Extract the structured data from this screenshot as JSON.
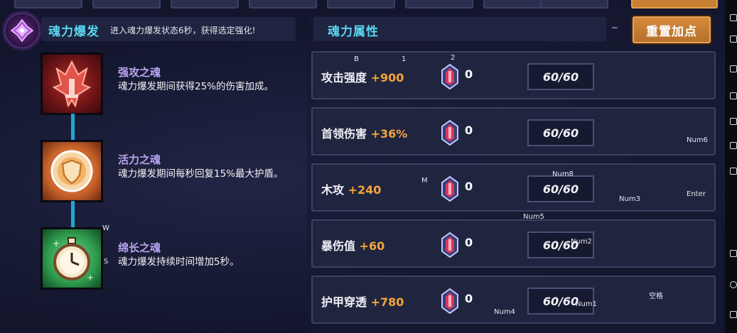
{
  "burst": {
    "title": "魂力爆发",
    "desc": "进入魂力爆发状态6秒，获得选定强化!"
  },
  "souls": [
    {
      "name": "强攻之魂",
      "desc": "魂力爆发期间获得25%的伤害加成。",
      "icon": "red-flame-soul-icon"
    },
    {
      "name": "活力之魂",
      "desc": "魂力爆发期间每秒回复15%最大护盾。",
      "icon": "orange-shield-soul-icon"
    },
    {
      "name": "绵长之魂",
      "desc": "魂力爆发持续时间增加5秒。",
      "icon": "green-stopwatch-soul-icon"
    }
  ],
  "attributes_panel": {
    "title": "魂力属性",
    "tilde": "~",
    "reset_label": "重置加点"
  },
  "attributes": [
    {
      "name": "攻击强度",
      "bonus": "+900",
      "count": "0",
      "progress": "60/60"
    },
    {
      "name": "首领伤害",
      "bonus": "+36%",
      "count": "0",
      "progress": "60/60"
    },
    {
      "name": "木攻",
      "bonus": "+240",
      "count": "0",
      "progress": "60/60"
    },
    {
      "name": "暴伤值",
      "bonus": "+60",
      "count": "0",
      "progress": "60/60"
    },
    {
      "name": "护甲穿透",
      "bonus": "+780",
      "count": "0",
      "progress": "60/60"
    }
  ],
  "key_hints": {
    "b": "B",
    "one": "1",
    "two": "2",
    "m": "M",
    "w": "W",
    "s": "S",
    "num1": "Num1",
    "num2": "Num2",
    "num3": "Num3",
    "num4": "Num4",
    "num5": "Num5",
    "num6": "Num6",
    "num8": "Num8",
    "enter": "Enter",
    "space": "空格"
  },
  "colors": {
    "accent_cyan": "#5ad6f0",
    "bonus_orange": "#f5a43a",
    "soul_name_purple": "#b9a6f0",
    "reset_button": "#c98132"
  }
}
